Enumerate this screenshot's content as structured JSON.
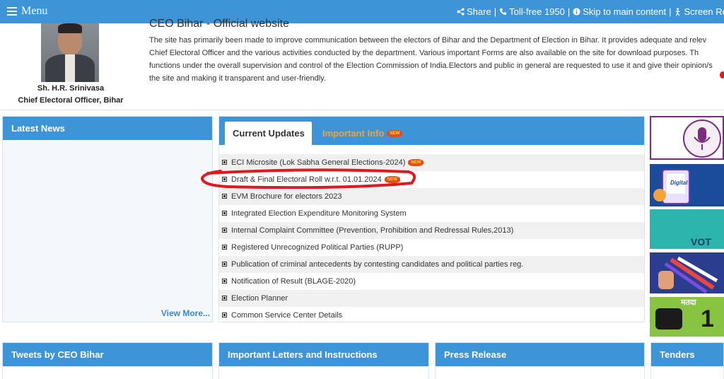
{
  "topbar": {
    "menu_label": "Menu",
    "share_label": "Share",
    "tollfree_label": "Toll-free 1950",
    "skip_label": "Skip to main content",
    "screen_reader_label": "Screen Re",
    "separator": "|"
  },
  "header": {
    "site_title": "CEO Bihar - Official website",
    "intro_lines": [
      "The site has primarily been made to improve communication between the electors of Bihar and the Department of Election in Bihar. It provides adequate and relev",
      "Chief Electoral Officer and the various activities conducted by the department. Various important Forms are also available on the site for download purposes. Th",
      "functions under the overall supervision and control of the Election Commission of India.Electors and public in general are requested to use it and give their opinion/s",
      "the site and making it transparent and user-friendly."
    ],
    "officer_name": "Sh. H.R. Srinivasa",
    "officer_title": "Chief Electoral Officer, Bihar"
  },
  "latest_news": {
    "title": "Latest News",
    "view_more": "View More..."
  },
  "updates": {
    "tab_current": "Current Updates",
    "tab_important": "Important Info",
    "new_badge": "NEW",
    "items": [
      {
        "label": "ECI Microsite (Lok Sabha General Elections-2024)",
        "is_new": true
      },
      {
        "label": "Draft & Final Electoral Roll w.r.t. 01.01.2024",
        "is_new": true
      },
      {
        "label": "EVM Brochure for electors 2023",
        "is_new": false
      },
      {
        "label": "Integrated Election Expenditure Monitoring System",
        "is_new": false
      },
      {
        "label": "Internal Complaint Committee (Prevention, Prohibition and Redressal Rules,2013)",
        "is_new": false
      },
      {
        "label": "Registered Unrecognized Political Parties (RUPP)",
        "is_new": false
      },
      {
        "label": "Publication of criminal antecedents by contesting candidates and political parties reg.",
        "is_new": false
      },
      {
        "label": "Notification of Result (BLAGE-2020)",
        "is_new": false
      },
      {
        "label": "Election Planner",
        "is_new": false
      },
      {
        "label": "Common Service Center Details",
        "is_new": false
      }
    ]
  },
  "banners": {
    "digital_label": "Digital",
    "vote_label": "VOT",
    "matdata_label": "मतदा",
    "one_label": "1"
  },
  "bottom": {
    "tweets_title": "Tweets by CEO Bihar",
    "letters_title": "Important Letters and Instructions",
    "press_title": "Press Release",
    "tenders_title": "Tenders"
  },
  "colors": {
    "accent_blue": "#3d95d7",
    "important_orange": "#f0a33a",
    "annotation_red": "#e0191f"
  }
}
